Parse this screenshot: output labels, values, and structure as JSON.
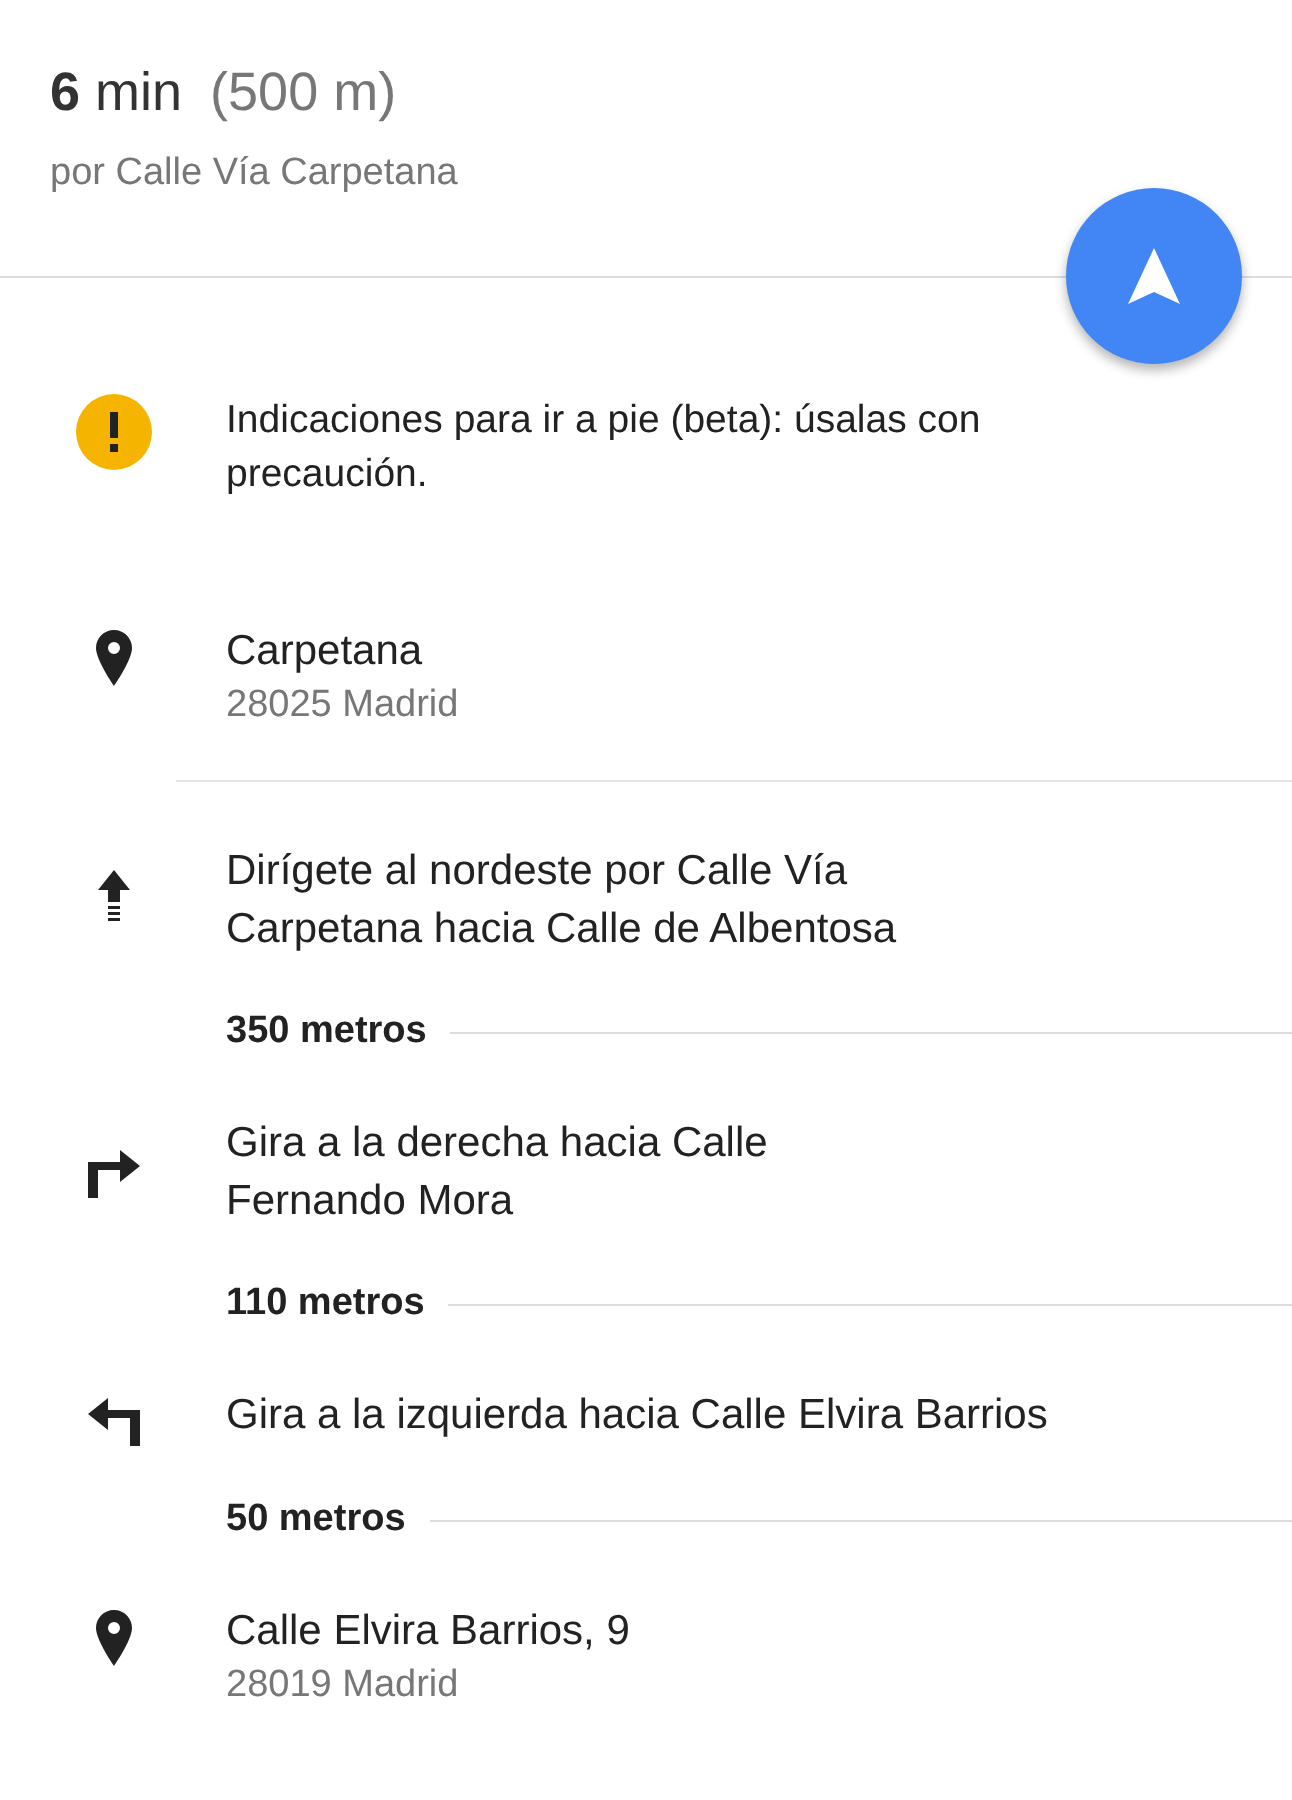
{
  "header": {
    "duration": "**6** min",
    "distance": "(500 m)",
    "via": "por Calle Vía Carpetana"
  },
  "items": [
    {
      "kind": "warning",
      "text": "Indicaciones para ir a pie (beta): úsalas con\nprecaución."
    },
    {
      "kind": "place",
      "name": "Carpetana",
      "address": "28025 Madrid"
    },
    {
      "kind": "straight",
      "text": "Dirígete al nordeste por Calle Vía\nCarpetana hacia Calle de Albentosa",
      "distance": "350 metros"
    },
    {
      "kind": "right",
      "text": "Gira a la derecha hacia Calle\nFernando Mora",
      "distance": "110 metros"
    },
    {
      "kind": "left",
      "text": "Gira a la izquierda hacia Calle Elvira Barrios",
      "distance": "50 metros"
    },
    {
      "kind": "place",
      "name": "Calle Elvira Barrios, 9",
      "address": "28019 Madrid"
    }
  ]
}
